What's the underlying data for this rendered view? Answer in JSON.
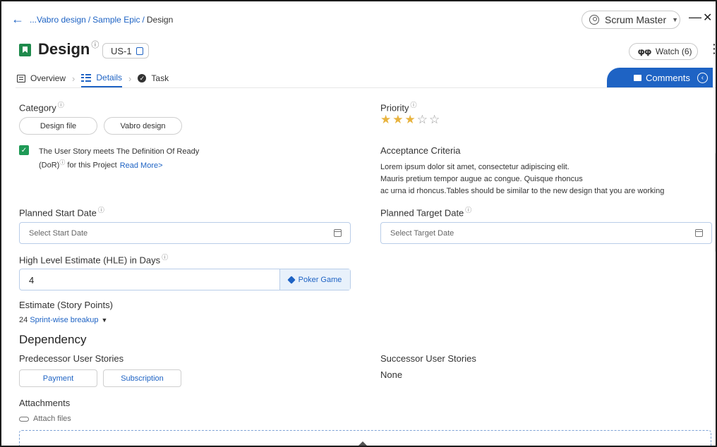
{
  "nav": {
    "back_icon": "arrow-left-icon",
    "breadcrumb": [
      "...Vabro design",
      "Sample Epic",
      "Design"
    ],
    "role": "Scrum Master",
    "min": "—",
    "close": "✕"
  },
  "header": {
    "title": "Design",
    "info": "ⓘ",
    "id": "US-1",
    "watch": "Watch (6)",
    "more": "⋮"
  },
  "tabs": [
    {
      "label": "Overview"
    },
    {
      "label": "Details"
    },
    {
      "label": "Task"
    }
  ],
  "comments": {
    "label": "Comments",
    "toggle": "‹"
  },
  "category": {
    "label": "Category",
    "chips": [
      "Design file",
      "Vabro design"
    ]
  },
  "priority": {
    "label": "Priority",
    "rating": 3,
    "max": 5
  },
  "dor": {
    "line1": "The User Story meets The Definition Of Ready",
    "line2": "(DoR)",
    "line2b": " for this Project",
    "link": "Read More>"
  },
  "acceptance": {
    "label": "Acceptance Criteria",
    "lines": [
      "Lorem ipsum dolor sit amet, consectetur adipiscing elit.",
      "Mauris pretium tempor augue ac congue. Quisque rhoncus",
      "ac urna id rhoncus.Tables should be similar to the new design that you are working"
    ]
  },
  "planned_start": {
    "label": "Planned Start Date",
    "placeholder": "Select Start Date"
  },
  "planned_target": {
    "label": "Planned Target Date",
    "placeholder": "Select Target Date"
  },
  "hle": {
    "label": "High Level Estimate (HLE) in Days",
    "value": "4",
    "poker": "Poker Game"
  },
  "estimate": {
    "label": "Estimate (Story Points)",
    "value": "24",
    "link": "Sprint-wise breakup",
    "caret": "▼"
  },
  "dependency": {
    "title": "Dependency",
    "predecessor_label": "Predecessor User Stories",
    "predecessors": [
      "Payment",
      "Subscription"
    ],
    "successor_label": "Successor User Stories",
    "successor_value": "None"
  },
  "attachments": {
    "label": "Attachments",
    "attach": "Attach files"
  },
  "colors": {
    "accent": "#1e63c4",
    "green": "#1f8a4c",
    "star": "#e8b33e"
  }
}
